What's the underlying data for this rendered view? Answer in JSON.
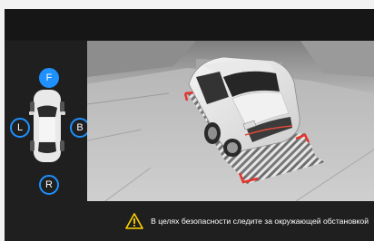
{
  "colors": {
    "accent": "#1e90ff",
    "warning": "#ffd400",
    "guide_red": "#e8322a",
    "background": "#1a1a1a"
  },
  "views": {
    "front": "F",
    "left": "L",
    "right": "B",
    "rear": "R",
    "active": "front"
  },
  "icons": {
    "warning": "warning-triangle-icon",
    "car": "car-top-view-icon"
  },
  "notice": {
    "text": "В целях безопасности следите за окружающей обстановкой"
  }
}
